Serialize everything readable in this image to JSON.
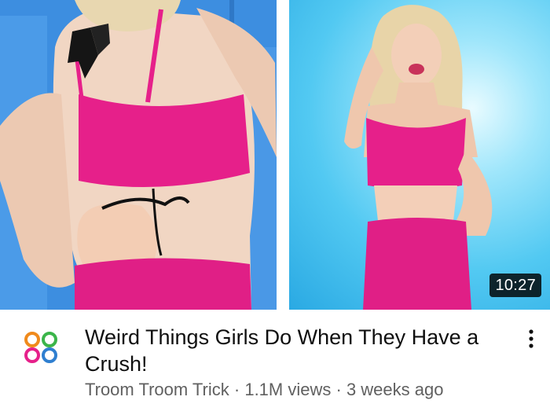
{
  "video": {
    "duration": "10:27",
    "title": "Weird Things Girls Do When They Have a Crush!",
    "channel": "Troom Troom Trick",
    "views": "1.1M views",
    "age": "3 weeks ago",
    "separator": " · "
  },
  "icons": {
    "avatar": "channel-logo-icon",
    "menu": "more-vert-icon"
  },
  "colors": {
    "title": "#0f0f0f",
    "subtitle": "#606060",
    "duration_bg": "#000000",
    "top_pink": "#e6208a",
    "logo_orange": "#f08a1c",
    "logo_green": "#3bb54a",
    "logo_blue": "#2f7fd0",
    "logo_pink": "#e6208a"
  }
}
